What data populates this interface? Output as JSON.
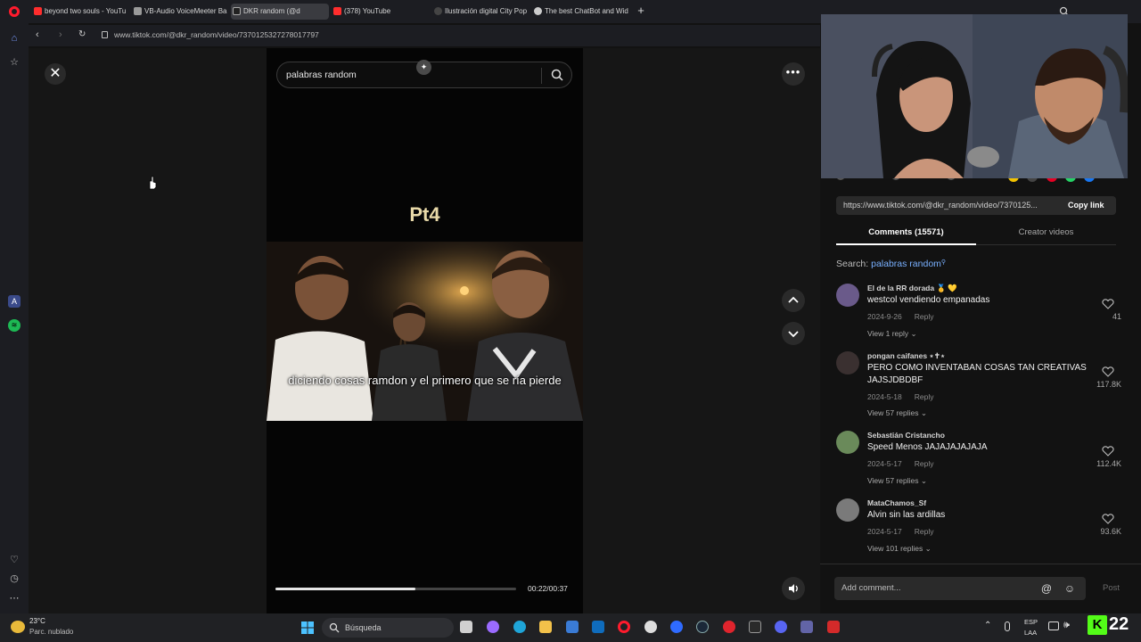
{
  "browser": {
    "tabs": [
      {
        "label": "beyond two souls - YouTu",
        "icon_color": "#ff2d2d"
      },
      {
        "label": "VB-Audio VoiceMeeter Ba",
        "icon_color": "#9a9a9a"
      },
      {
        "label": "DKR random (@d",
        "icon_color": "#222222"
      },
      {
        "label": "(378) YouTube",
        "icon_color": "#ff2d2d"
      },
      {
        "label": "Ilustración digital City Pop",
        "icon_color": "#444444"
      },
      {
        "label": "The best ChatBot and Wid",
        "icon_color": "#cccccc"
      }
    ],
    "url": "www.tiktok.com/@dkr_random/video/7370125327278017797"
  },
  "viewer": {
    "search_query": "palabras random",
    "video_title_overlay": "Pt4",
    "caption": "diciendo cosas ramdon y el primero que se ría pierde",
    "time": "00:22/00:37",
    "progress": 0.58
  },
  "panel": {
    "share_url": "https://www.tiktok.com/@dkr_random/video/7370125...",
    "copy_link": "Copy link",
    "tab_comments": "Comments (15571)",
    "tab_creator": "Creator videos",
    "search_prefix": "Search: ",
    "search_term": "palabras random",
    "comments": [
      {
        "user": "El de la RR dorada 🥇 💛",
        "text": "westcol vendiendo empanadas",
        "date": "2024-9-26",
        "reply": "Reply",
        "likes": "41",
        "view": "View 1 reply",
        "avatar_color": "#6a5a8a"
      },
      {
        "user": "pongan caifanes ⋆✝⋆",
        "text": "PERO COMO INVENTABAN COSAS TAN CREATIVAS JAJSJDBDBF",
        "date": "2024-5-18",
        "reply": "Reply",
        "likes": "117.8K",
        "view": "View 57 replies",
        "avatar_color": "#3a3030"
      },
      {
        "user": "Sebastián Cristancho",
        "text": "Speed Menos JAJAJAJAJAJA",
        "date": "2024-5-17",
        "reply": "Reply",
        "likes": "112.4K",
        "view": "View 57 replies",
        "avatar_color": "#6a8a5a"
      },
      {
        "user": "MataChamos_Sf",
        "text": "Alvin sin las ardillas",
        "date": "2024-5-17",
        "reply": "Reply",
        "likes": "93.6K",
        "view": "View 101 replies",
        "avatar_color": "#7a7a7a"
      }
    ],
    "add_comment_placeholder": "Add comment...",
    "post": "Post"
  },
  "taskbar": {
    "temperature": "23°C",
    "weather": "Parc. nublado",
    "search_placeholder": "Búsqueda",
    "lang_line1": "ESP",
    "lang_line2": "LAA",
    "kick_number": "22"
  },
  "colors": {
    "accent_link": "#79b0ff",
    "opera_red": "#ff1b2d",
    "spotify_green": "#1db954"
  }
}
